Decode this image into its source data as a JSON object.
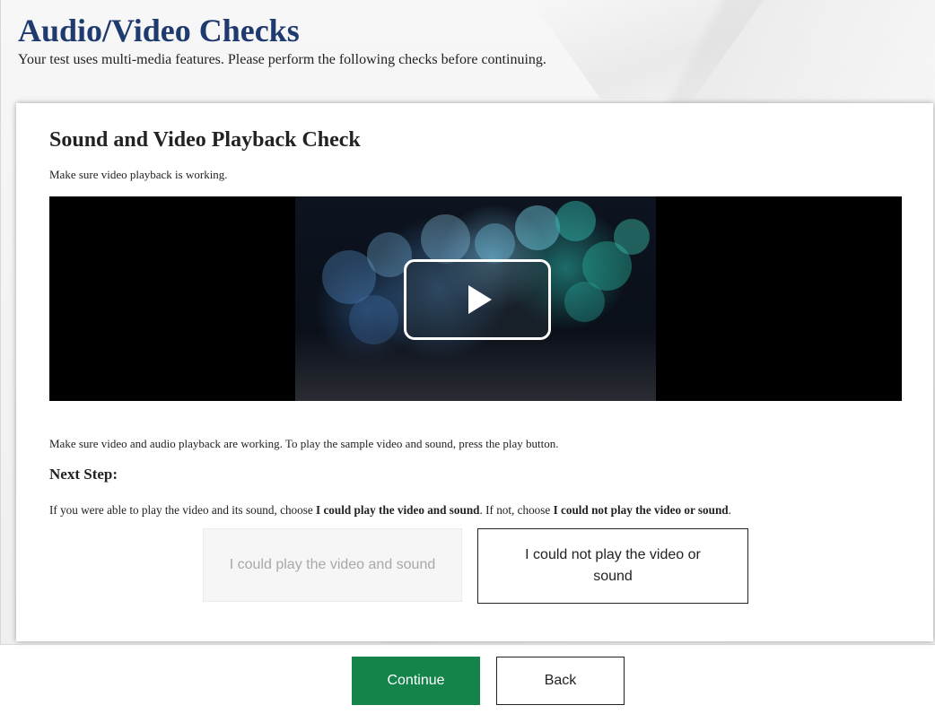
{
  "header": {
    "title": "Audio/Video Checks",
    "subtitle": "Your test uses multi-media features. Please perform the following checks before continuing."
  },
  "card": {
    "title": "Sound and Video Playback Check",
    "subtitle": "Make sure video playback is working.",
    "instructions": "Make sure video and audio playback are working. To play the sample video and sound, press the play button.",
    "next_step_heading": "Next Step:",
    "choice_text": {
      "part1": "If you were able to play the video and its sound, choose ",
      "bold1": "I could play the video and sound",
      "part2": ". If not, choose ",
      "bold2": "I could not play the video or sound",
      "part3": "."
    },
    "choice_yes_label": "I could play the video and sound",
    "choice_no_label": "I could not play the video or sound"
  },
  "video": {
    "play_icon": "play-icon"
  },
  "footer": {
    "continue_label": "Continue",
    "back_label": "Back"
  },
  "colors": {
    "title": "#1e3a6e",
    "continue_bg": "#14844a"
  }
}
